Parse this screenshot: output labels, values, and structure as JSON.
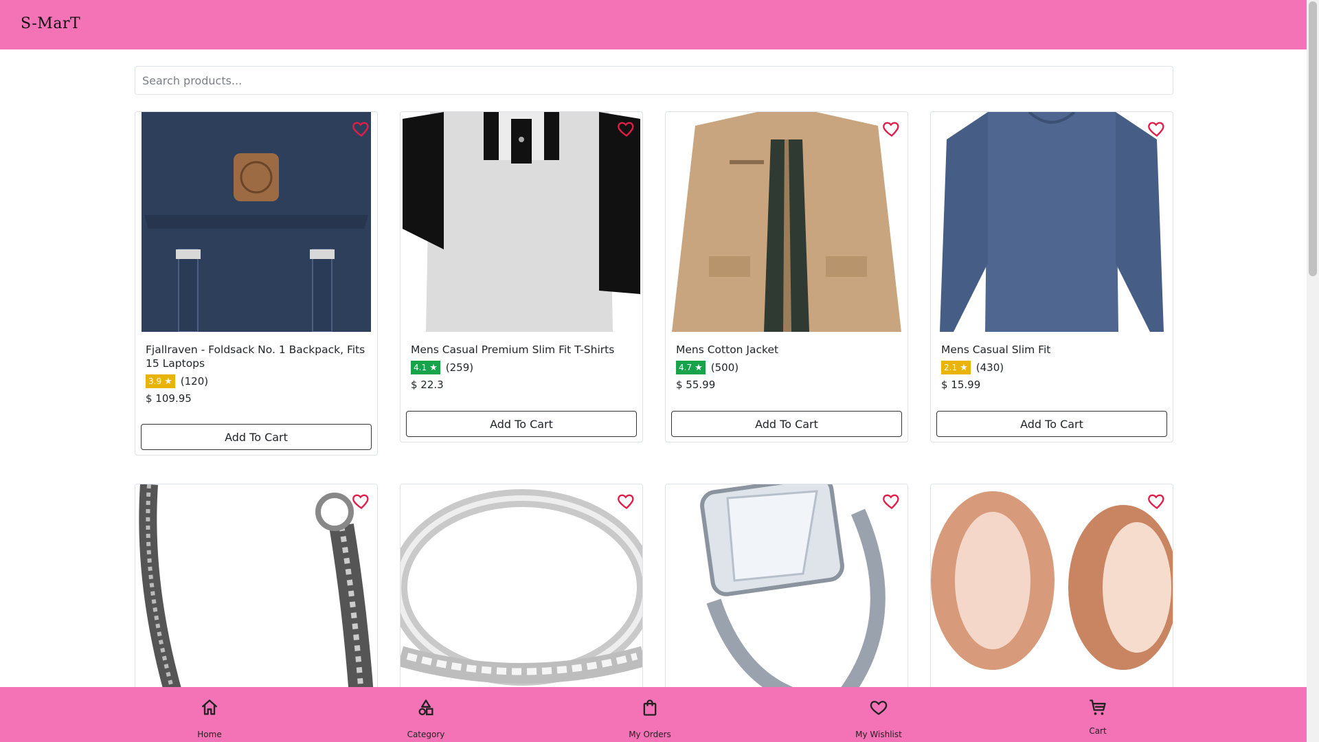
{
  "app": {
    "brand": "S-MarT"
  },
  "search": {
    "placeholder": "Search products..."
  },
  "products": [
    {
      "title": "Fjallraven - Foldsack No. 1 Backpack, Fits 15 Laptops",
      "rating": "3.9",
      "rating_color": "#eab308",
      "count": "(120)",
      "price": "$ 109.95",
      "button": "Add To Cart",
      "image": "backpack"
    },
    {
      "title": "Mens Casual Premium Slim Fit T-Shirts",
      "rating": "4.1",
      "rating_color": "#16a34a",
      "count": "(259)",
      "price": "$ 22.3",
      "button": "Add To Cart",
      "image": "raglan-tshirt"
    },
    {
      "title": "Mens Cotton Jacket",
      "rating": "4.7",
      "rating_color": "#16a34a",
      "count": "(500)",
      "price": "$ 55.99",
      "button": "Add To Cart",
      "image": "cotton-jacket"
    },
    {
      "title": "Mens Casual Slim Fit",
      "rating": "2.1",
      "rating_color": "#eab308",
      "count": "(430)",
      "price": "$ 15.99",
      "button": "Add To Cart",
      "image": "long-sleeve-shirt"
    },
    {
      "image": "silver-bracelet"
    },
    {
      "image": "silver-band-ring"
    },
    {
      "image": "diamond-ring-set"
    },
    {
      "image": "rose-gold-plugs"
    }
  ],
  "icons": {
    "wishlist": "heart-outline-icon"
  },
  "bottom_nav": [
    {
      "label": "Home",
      "icon": "home-icon"
    },
    {
      "label": "Category",
      "icon": "shapes-icon"
    },
    {
      "label": "My Orders",
      "icon": "shopping-bag-icon"
    },
    {
      "label": "My Wishlist",
      "icon": "heart-icon"
    },
    {
      "label": "Cart",
      "icon": "cart-icon"
    }
  ],
  "colors": {
    "brand_pink": "#f472b6",
    "heart": "#e11d48",
    "rating_high": "#16a34a",
    "rating_mid": "#eab308"
  }
}
